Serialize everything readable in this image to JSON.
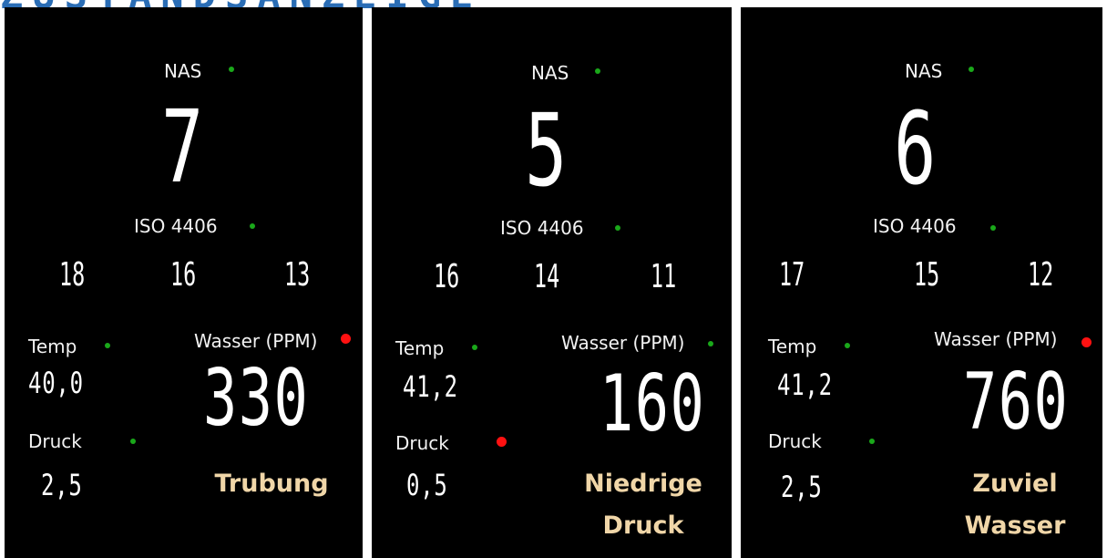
{
  "banner": {
    "text": "ZUSTANDSANZEIGE"
  },
  "labels": {
    "nas": "NAS",
    "iso": "ISO 4406",
    "temp": "Temp",
    "water": "Wasser (PPM)",
    "pressure": "Druck"
  },
  "colors": {
    "ok": "#1aa81a",
    "alarm": "#ff1111",
    "status_text": "#f0d6a8"
  },
  "panels": [
    {
      "nas": "7",
      "iso": [
        "18",
        "16",
        "13"
      ],
      "temp": "40,0",
      "pressure": "2,5",
      "water": "330",
      "status": {
        "line1": "Trubung",
        "line2": ""
      },
      "indicators": {
        "nas": "ok",
        "iso": "ok",
        "temp": "ok",
        "pressure": "ok",
        "water": "alarm"
      }
    },
    {
      "nas": "5",
      "iso": [
        "16",
        "14",
        "11"
      ],
      "temp": "41,2",
      "pressure": "0,5",
      "water": "160",
      "status": {
        "line1": "Niedrige",
        "line2": "Druck"
      },
      "indicators": {
        "nas": "ok",
        "iso": "ok",
        "temp": "ok",
        "pressure": "alarm",
        "water": "ok"
      }
    },
    {
      "nas": "6",
      "iso": [
        "17",
        "15",
        "12"
      ],
      "temp": "41,2",
      "pressure": "2,5",
      "water": "760",
      "status": {
        "line1": "Zuviel",
        "line2": "Wasser"
      },
      "indicators": {
        "nas": "ok",
        "iso": "ok",
        "temp": "ok",
        "pressure": "ok",
        "water": "alarm"
      }
    }
  ]
}
